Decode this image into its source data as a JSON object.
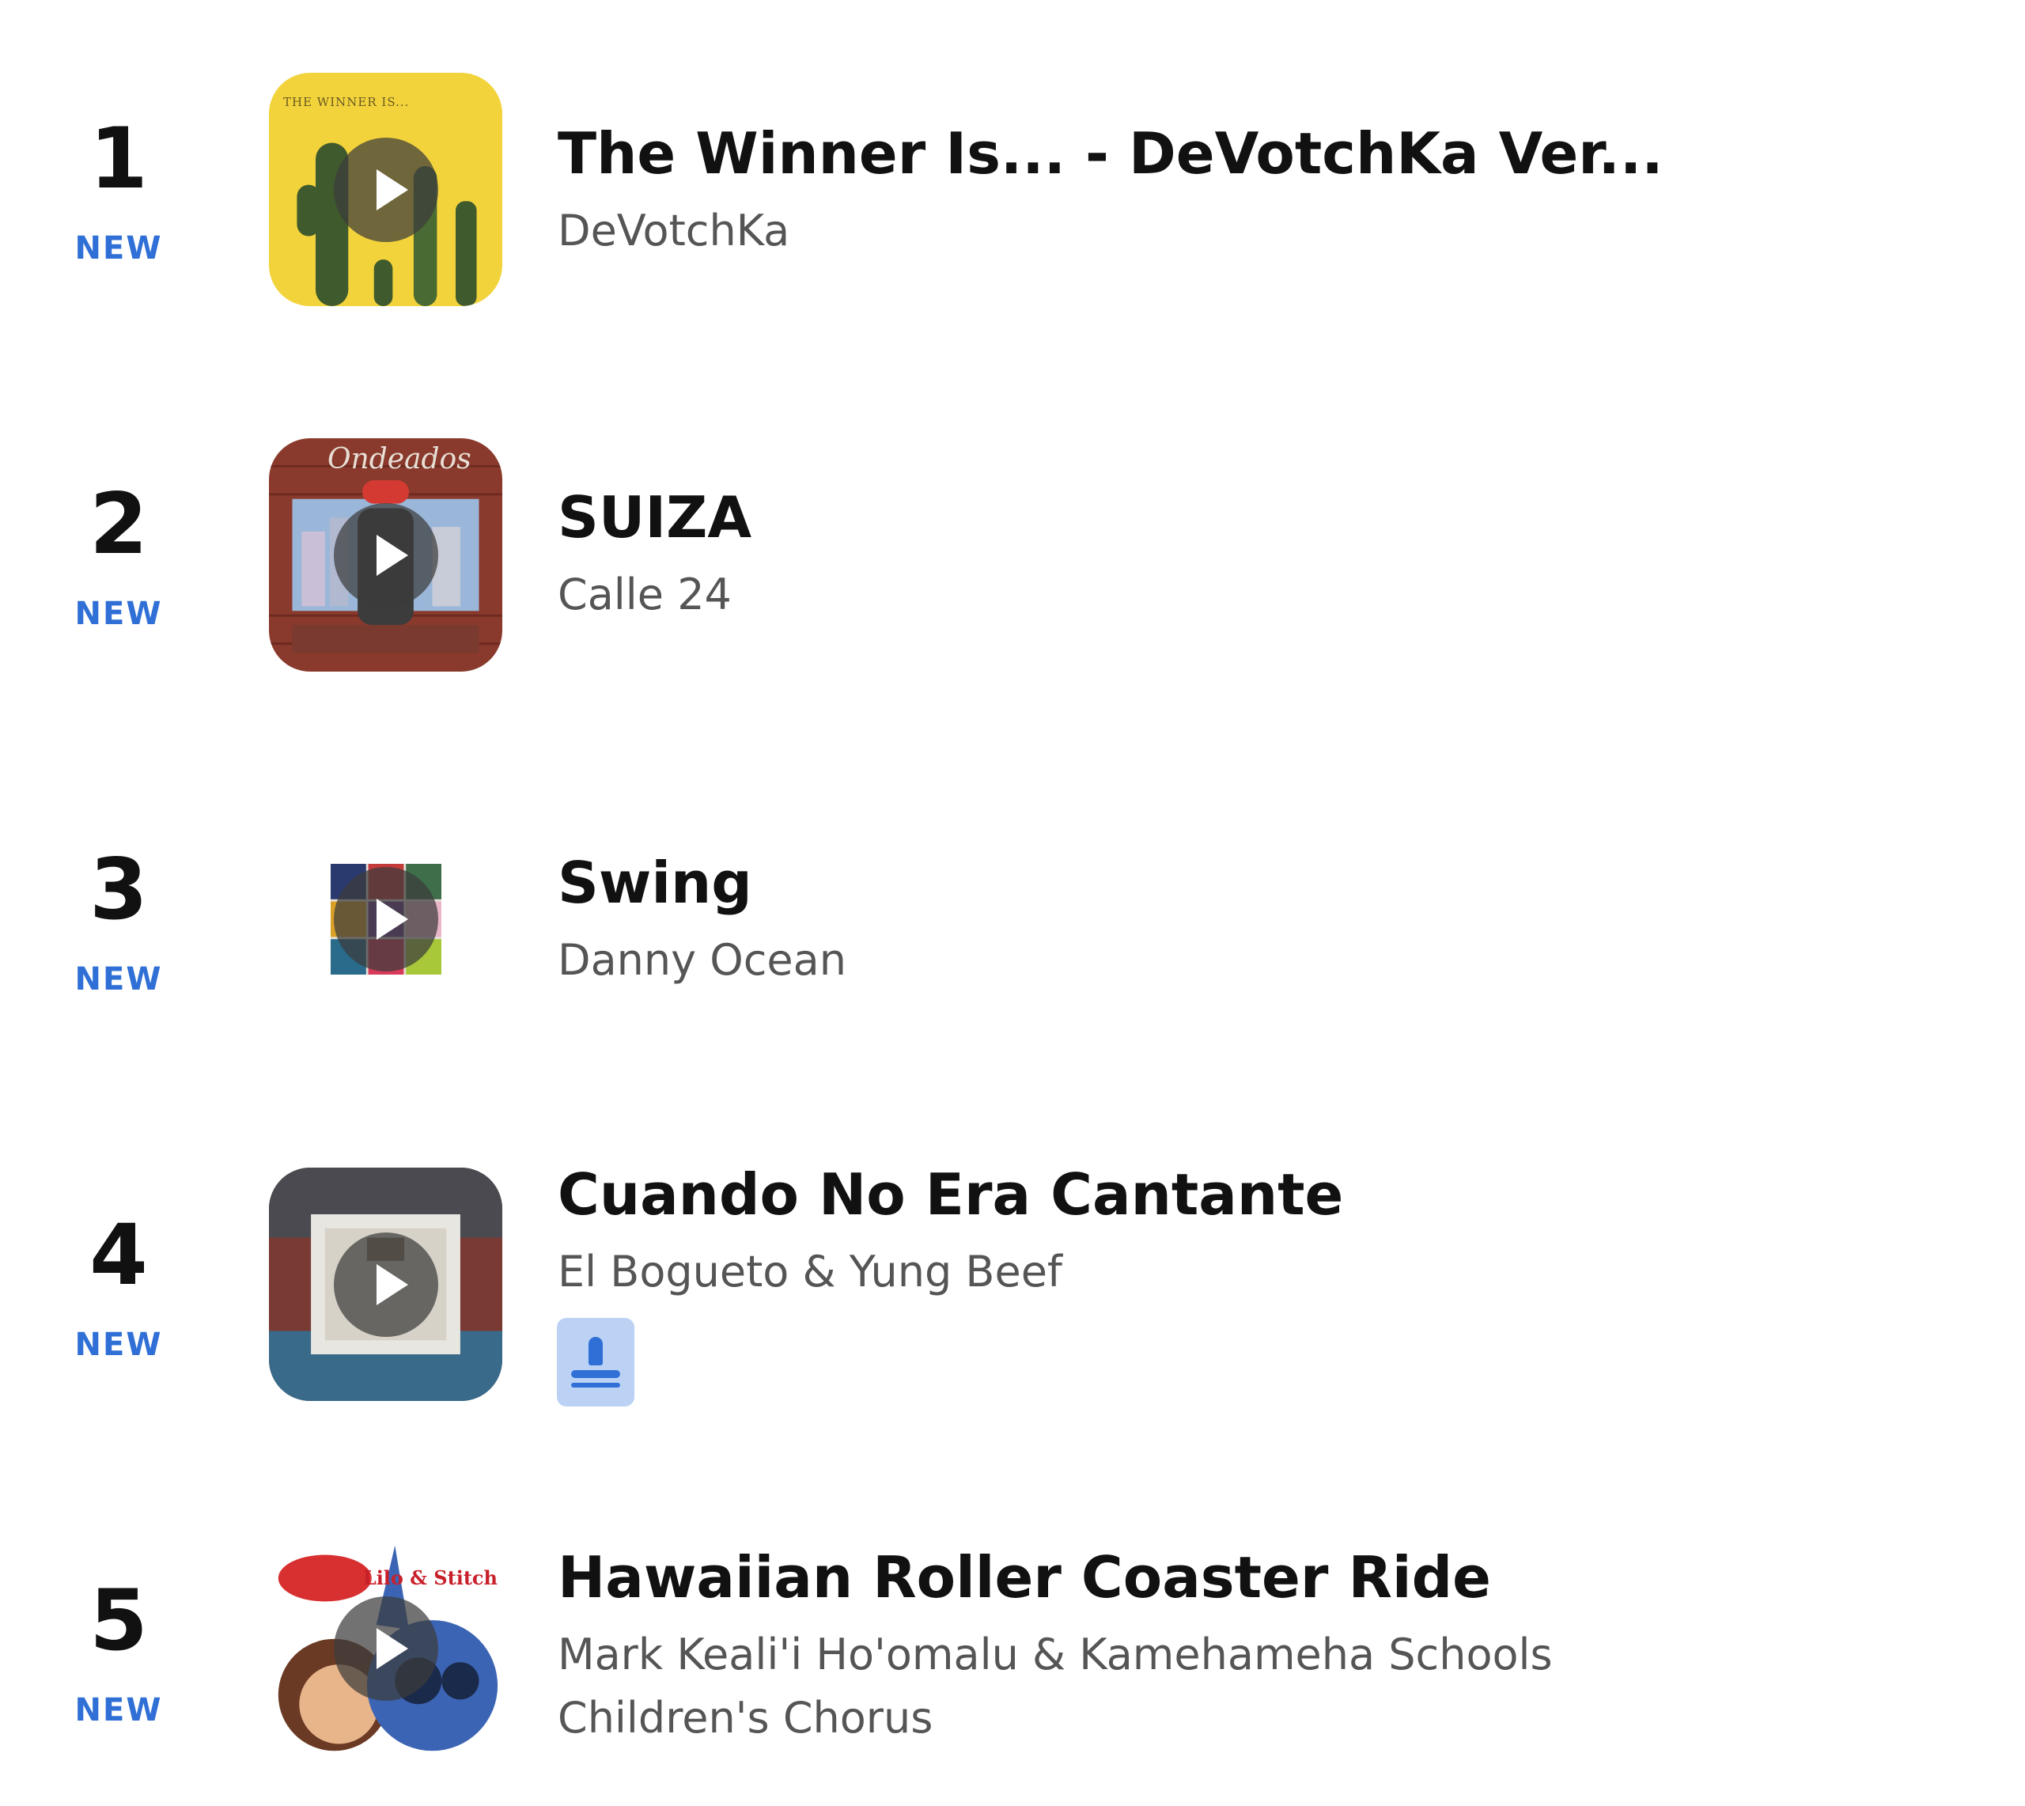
{
  "chart": {
    "items": [
      {
        "rank": "1",
        "badge": "NEW",
        "title": "The Winner Is... - DeVotchKa Ver...",
        "artist": "DeVotchKa",
        "art_text": "THE WINNER IS..."
      },
      {
        "rank": "2",
        "badge": "NEW",
        "title": "SUIZA",
        "artist": "Calle 24",
        "art_text": "Ondeados"
      },
      {
        "rank": "3",
        "badge": "NEW",
        "title": "Swing",
        "artist": "Danny Ocean"
      },
      {
        "rank": "4",
        "badge": "NEW",
        "title": "Cuando No Era Cantante",
        "artist": "El Bogueto & Yung Beef"
      },
      {
        "rank": "5",
        "badge": "NEW",
        "title": "Hawaiian Roller Coaster Ride",
        "artist": "Mark Keali'i Ho'omalu & Kamehameha Schools Children's Chorus",
        "art_text": "Lilo & Stitch"
      }
    ]
  },
  "colors": {
    "badge": "#2f6fd6",
    "title": "#111111",
    "artist": "#555555",
    "lyrics_button_bg": "#bcd2f5"
  },
  "icons": {
    "play": "play-icon",
    "lyrics": "stamp-icon"
  }
}
